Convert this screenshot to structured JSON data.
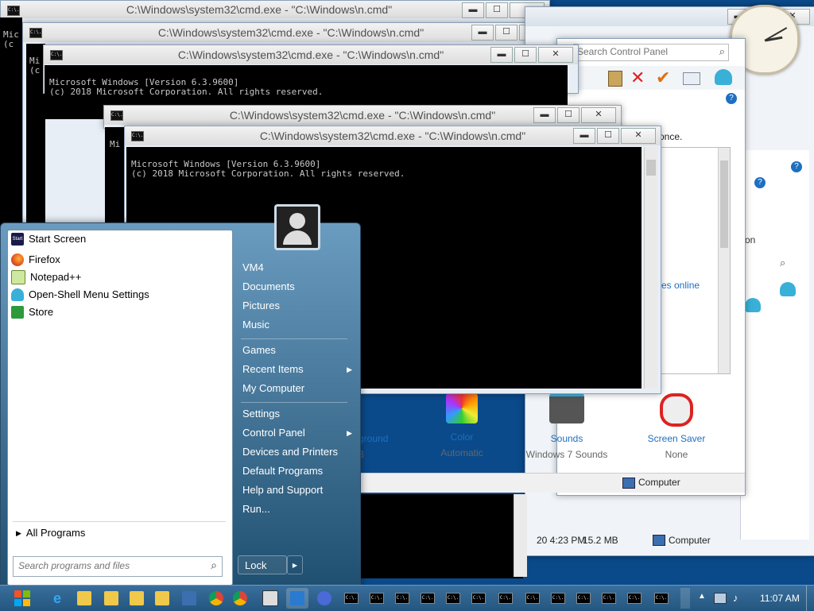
{
  "console": {
    "title": "C:\\Windows\\system32\\cmd.exe - \"C:\\Windows\\n.cmd\"",
    "icon_text": "C:\\.",
    "line1": "Microsoft Windows [Version 6.3.9600]",
    "line2": "(c) 2018 Microsoft Corporation. All rights reserved.",
    "frag_mic": "Mic",
    "frag_c": "(c",
    "frag_mi": "Mi",
    "frag_c2": "(c"
  },
  "window_controls": {
    "minimize": "▬",
    "maximize": "☐",
    "close": "✕"
  },
  "control_panel": {
    "search_placeholder": "Search Control Panel",
    "fragment_once": "once.",
    "fragment_on": "on",
    "fragment_online": "es online",
    "personalize": [
      {
        "label": "ground",
        "sub": "3"
      },
      {
        "label": "Color",
        "sub": "Automatic"
      },
      {
        "label": "Sounds",
        "sub": "Windows 7 Sounds"
      },
      {
        "label": "Screen Saver",
        "sub": "None"
      }
    ],
    "status_computer": "Computer",
    "status_date": "20 4:23 PM",
    "status_size": "15.2 MB",
    "status_computer2": "Computer",
    "help": "?"
  },
  "start_menu": {
    "programs": [
      "Start Screen",
      "Firefox",
      "Notepad++",
      "Open-Shell Menu Settings",
      "Store"
    ],
    "all_programs": "All Programs",
    "search_placeholder": "Search programs and files",
    "right_items_1": [
      "VM4",
      "Documents",
      "Pictures",
      "Music"
    ],
    "right_items_2": [
      "Games",
      "Recent Items",
      "My Computer"
    ],
    "right_items_3": [
      "Settings",
      "Control Panel",
      "Devices and Printers",
      "Default Programs",
      "Help and Support",
      "Run..."
    ],
    "lock": "Lock",
    "arrow": "▶",
    "start_screen_icon": "Start"
  },
  "taskbar": {
    "time": "11:07 AM",
    "cmd_icon": "C:\\."
  },
  "colors": {
    "accent": "#1f5a86",
    "cmd_bg": "#000000",
    "link_blue": "#1e6fc0"
  }
}
